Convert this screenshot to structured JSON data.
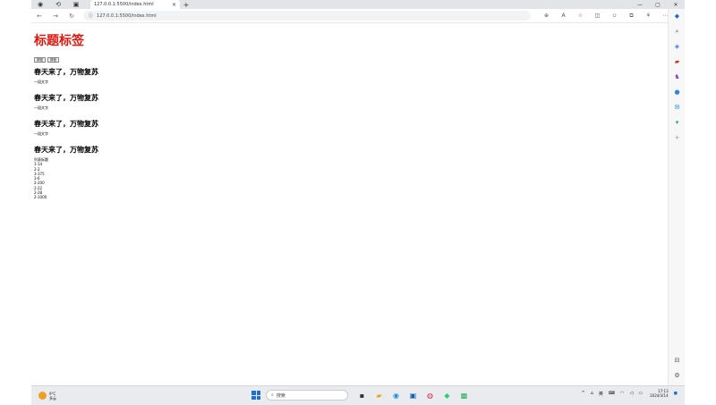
{
  "browser": {
    "tab_title": "127.0.0.1:5500/index.html",
    "tab_close": "×",
    "newtab": "+",
    "url": "127.0.0.1:5500/index.html",
    "win_min": "—",
    "win_max": "▢",
    "win_close": "✕"
  },
  "page": {
    "title": "标题标签",
    "buttons": [
      "按钮",
      "按钮"
    ],
    "sections": [
      {
        "heading": "春天来了，万物复苏",
        "text": "一段文字"
      },
      {
        "heading": "春天来了，万物复苏",
        "text": "一段文字"
      },
      {
        "heading": "春天来了，万物复苏",
        "text": "一段文字"
      },
      {
        "heading": "春天来了，万物复苏"
      }
    ],
    "list_title": "列表标题",
    "list_items": [
      "1-14",
      "2-2",
      "3-375",
      "3-6",
      "2-200",
      "2-22",
      "2-28",
      "2-1000"
    ]
  },
  "taskbar": {
    "weather_temp": "9°C",
    "weather_desc": "多云",
    "search_placeholder": "搜索",
    "lang": "英",
    "time": "17:13",
    "date": "2024/3/14"
  },
  "colors": {
    "title": "#e4140c",
    "accent": "#1c6fd8"
  }
}
